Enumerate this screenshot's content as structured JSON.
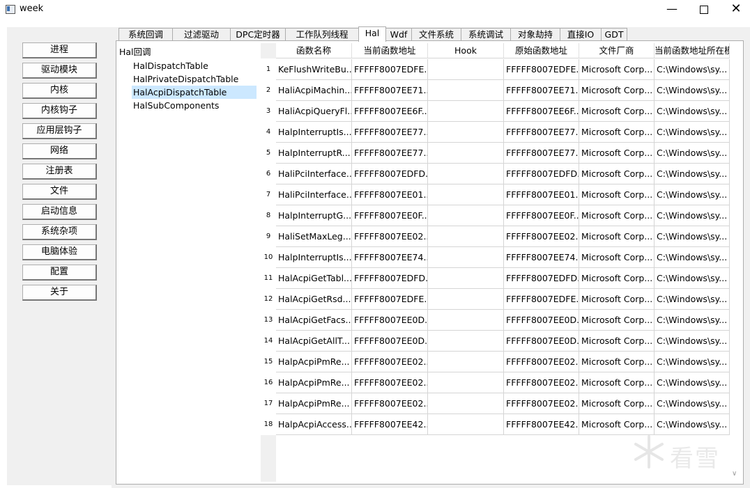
{
  "window": {
    "title": "week"
  },
  "sidebar": {
    "buttons": [
      "进程",
      "驱动模块",
      "内核",
      "内核钩子",
      "应用层钩子",
      "网络",
      "注册表",
      "文件",
      "启动信息",
      "系统杂项",
      "电脑体验",
      "配置",
      "关于"
    ]
  },
  "tabs": [
    "系统回调",
    "过滤驱动",
    "DPC定时器",
    "工作队列线程",
    "Hal",
    "Wdf",
    "文件系统",
    "系统调试",
    "对象劫持",
    "直接IO",
    "GDT"
  ],
  "active_tab": "Hal",
  "tree": {
    "header": "Hal回调",
    "items": [
      "HalDispatchTable",
      "HalPrivateDispatchTable",
      "HalAcpiDispatchTable",
      "HalSubComponents"
    ],
    "selected": "HalAcpiDispatchTable"
  },
  "table": {
    "columns": [
      "函数名称",
      "当前函数地址",
      "Hook",
      "原始函数地址",
      "文件厂商",
      "当前函数地址所在模块"
    ],
    "rows": [
      [
        "1",
        "KeFlushWriteBu...",
        "FFFFF8007EDFE...",
        "",
        "FFFFF8007EDFE...",
        "Microsoft Corp...",
        "C:\\Windows\\sy..."
      ],
      [
        "2",
        "HaliAcpiMachin...",
        "FFFFF8007EE71...",
        "",
        "FFFFF8007EE71...",
        "Microsoft Corp...",
        "C:\\Windows\\sy..."
      ],
      [
        "3",
        "HaliAcpiQueryFl...",
        "FFFFF8007EE6F...",
        "",
        "FFFFF8007EE6F...",
        "Microsoft Corp...",
        "C:\\Windows\\sy..."
      ],
      [
        "4",
        "HalpInterruptIs...",
        "FFFFF8007EE77...",
        "",
        "FFFFF8007EE77...",
        "Microsoft Corp...",
        "C:\\Windows\\sy..."
      ],
      [
        "5",
        "HalpInterruptR...",
        "FFFFF8007EE77...",
        "",
        "FFFFF8007EE77...",
        "Microsoft Corp...",
        "C:\\Windows\\sy..."
      ],
      [
        "6",
        "HaliPciInterface...",
        "FFFFF8007EDFD...",
        "",
        "FFFFF8007EDFD...",
        "Microsoft Corp...",
        "C:\\Windows\\sy..."
      ],
      [
        "7",
        "HaliPciInterface...",
        "FFFFF8007EE01...",
        "",
        "FFFFF8007EE01...",
        "Microsoft Corp...",
        "C:\\Windows\\sy..."
      ],
      [
        "8",
        "HalpInterruptG...",
        "FFFFF8007EE0F...",
        "",
        "FFFFF8007EE0F...",
        "Microsoft Corp...",
        "C:\\Windows\\sy..."
      ],
      [
        "9",
        "HaliSetMaxLeg...",
        "FFFFF8007EE02...",
        "",
        "FFFFF8007EE02...",
        "Microsoft Corp...",
        "C:\\Windows\\sy..."
      ],
      [
        "10",
        "HalpInterruptIs...",
        "FFFFF8007EE74...",
        "",
        "FFFFF8007EE74...",
        "Microsoft Corp...",
        "C:\\Windows\\sy..."
      ],
      [
        "11",
        "HalAcpiGetTabl...",
        "FFFFF8007EDFD...",
        "",
        "FFFFF8007EDFD...",
        "Microsoft Corp...",
        "C:\\Windows\\sy..."
      ],
      [
        "12",
        "HalAcpiGetRsd...",
        "FFFFF8007EDFE...",
        "",
        "FFFFF8007EDFE...",
        "Microsoft Corp...",
        "C:\\Windows\\sy..."
      ],
      [
        "13",
        "HalAcpiGetFacs...",
        "FFFFF8007EE0D...",
        "",
        "FFFFF8007EE0D...",
        "Microsoft Corp...",
        "C:\\Windows\\sy..."
      ],
      [
        "14",
        "HalAcpiGetAllT...",
        "FFFFF8007EE0D...",
        "",
        "FFFFF8007EE0D...",
        "Microsoft Corp...",
        "C:\\Windows\\sy..."
      ],
      [
        "15",
        "HalpAcpiPmRe...",
        "FFFFF8007EE02...",
        "",
        "FFFFF8007EE02...",
        "Microsoft Corp...",
        "C:\\Windows\\sy..."
      ],
      [
        "16",
        "HalpAcpiPmRe...",
        "FFFFF8007EE02...",
        "",
        "FFFFF8007EE02...",
        "Microsoft Corp...",
        "C:\\Windows\\sy..."
      ],
      [
        "17",
        "HalpAcpiPmRe...",
        "FFFFF8007EE02...",
        "",
        "FFFFF8007EE02...",
        "Microsoft Corp...",
        "C:\\Windows\\sy..."
      ],
      [
        "18",
        "HalpAcpiAccess...",
        "FFFFF8007EE42...",
        "",
        "FFFFF8007EE42...",
        "Microsoft Corp...",
        "C:\\Windows\\sy..."
      ]
    ]
  },
  "watermark": {
    "text": "看雪"
  },
  "colors": {
    "selection": "#cce8ff",
    "panel_bg": "#f0f0f0"
  }
}
